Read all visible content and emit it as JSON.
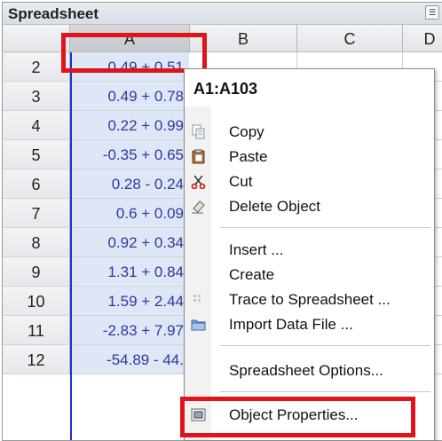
{
  "panel": {
    "title": "Spreadsheet",
    "menu_icon": "panel-menu-icon"
  },
  "columns": [
    "A",
    "B",
    "C",
    "D"
  ],
  "rows": [
    {
      "num": "2",
      "a": "0.49 + 0.51"
    },
    {
      "num": "3",
      "a": "0.49 + 0.78"
    },
    {
      "num": "4",
      "a": "0.22 + 0.99"
    },
    {
      "num": "5",
      "a": "-0.35 + 0.65"
    },
    {
      "num": "6",
      "a": "0.28 - 0.24"
    },
    {
      "num": "7",
      "a": "0.6 + 0.09"
    },
    {
      "num": "8",
      "a": "0.92 + 0.34"
    },
    {
      "num": "9",
      "a": "1.31 + 0.84"
    },
    {
      "num": "10",
      "a": "1.59 + 2.44"
    },
    {
      "num": "11",
      "a": "-2.83 + 7.97"
    },
    {
      "num": "12",
      "a": "-54.89 - 44."
    }
  ],
  "context_menu": {
    "title": "A1:A103",
    "items": {
      "copy": "Copy",
      "paste": "Paste",
      "cut": "Cut",
      "delete_object": "Delete Object",
      "insert": "Insert ...",
      "create": "Create",
      "trace": "Trace to Spreadsheet ...",
      "import": "Import Data File ...",
      "options": "Spreadsheet Options...",
      "properties": "Object Properties..."
    }
  },
  "colors": {
    "highlight": "#e0141a",
    "selection_line": "#1c2fd6",
    "selected_cell_bg": "#dfe7f7"
  }
}
